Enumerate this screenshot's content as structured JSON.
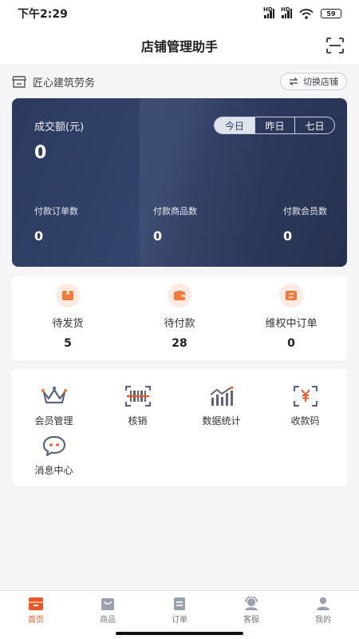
{
  "status_bar": {
    "time": "下午2:29",
    "battery": "59",
    "hd1": "HD",
    "hd2": "HD"
  },
  "header": {
    "title": "店铺管理助手",
    "scan_icon": "scan-icon"
  },
  "shop": {
    "name": "匠心建筑劳务",
    "switch_label": "切换店铺"
  },
  "stats": {
    "amount_label": "成交额(元)",
    "amount_value": "0",
    "tabs": [
      {
        "label": "今日",
        "active": true
      },
      {
        "label": "昨日",
        "active": false
      },
      {
        "label": "七日",
        "active": false
      }
    ],
    "metrics": [
      {
        "label": "付款订单数",
        "value": "0"
      },
      {
        "label": "付款商品数",
        "value": "0"
      },
      {
        "label": "付款会员数",
        "value": "0"
      }
    ]
  },
  "orders": [
    {
      "label": "待发货",
      "count": "5",
      "icon": "box-icon"
    },
    {
      "label": "待付款",
      "count": "28",
      "icon": "wallet-icon"
    },
    {
      "label": "维权中订单",
      "count": "0",
      "icon": "refund-icon"
    }
  ],
  "tools": [
    {
      "label": "会员管理",
      "icon": "crown-icon"
    },
    {
      "label": "核销",
      "icon": "barcode-icon"
    },
    {
      "label": "数据统计",
      "icon": "chart-icon"
    },
    {
      "label": "收款码",
      "icon": "yuan-scan-icon"
    },
    {
      "label": "消息中心",
      "icon": "message-icon"
    }
  ],
  "tab_bar": [
    {
      "label": "首页",
      "icon": "home-icon",
      "active": true
    },
    {
      "label": "商品",
      "icon": "bag-icon",
      "active": false
    },
    {
      "label": "订单",
      "icon": "order-icon",
      "active": false
    },
    {
      "label": "客服",
      "icon": "service-icon",
      "active": false
    },
    {
      "label": "我的",
      "icon": "user-icon",
      "active": false
    }
  ],
  "colors": {
    "accent": "#e8572a",
    "card": "#2c3a5e",
    "icon": "#5a6577"
  }
}
